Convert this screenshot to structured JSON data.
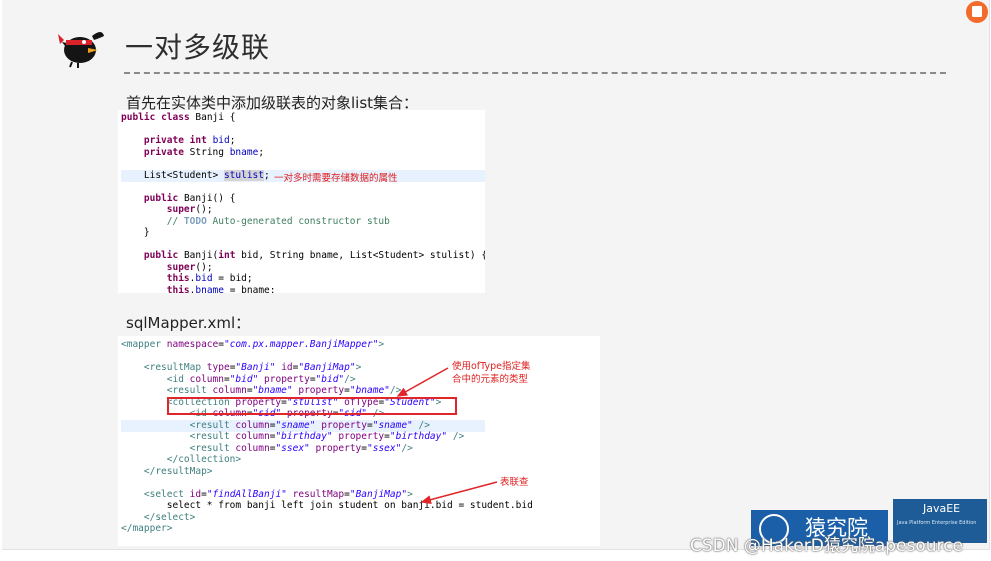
{
  "slide": {
    "title": "一对多级联",
    "subtitle_1": "首先在实体类中添加级联表的对象list集合：",
    "subtitle_2": "sqlMapper.xml："
  },
  "code_java": [
    {
      "t": [
        [
          "kw",
          "public"
        ],
        [
          "",
          " "
        ],
        [
          "kw",
          "class"
        ],
        [
          "",
          " Banji {"
        ]
      ]
    },
    {
      "t": []
    },
    {
      "t": [
        [
          "",
          "    "
        ],
        [
          "kw",
          "private"
        ],
        [
          "",
          " "
        ],
        [
          "kw",
          "int"
        ],
        [
          "",
          " "
        ],
        [
          "fld",
          "bid"
        ],
        [
          "",
          ";"
        ]
      ]
    },
    {
      "t": [
        [
          "",
          "    "
        ],
        [
          "kw",
          "private"
        ],
        [
          "",
          " String "
        ],
        [
          "fld",
          "bname"
        ],
        [
          "",
          ";"
        ]
      ]
    },
    {
      "t": []
    },
    {
      "t": [
        [
          "",
          "    List<Student> "
        ],
        [
          "fld",
          "stulist"
        ],
        [
          "",
          ";"
        ]
      ]
    },
    {
      "t": []
    },
    {
      "t": [
        [
          "",
          "    "
        ],
        [
          "kw",
          "public"
        ],
        [
          "",
          " Banji() {"
        ]
      ]
    },
    {
      "t": [
        [
          "",
          "        "
        ],
        [
          "kw",
          "super"
        ],
        [
          "",
          "();"
        ]
      ]
    },
    {
      "t": [
        [
          "cm",
          "        // "
        ],
        [
          "todo",
          "TODO"
        ],
        [
          "cm",
          " Auto-generated constructor stub"
        ]
      ]
    },
    {
      "t": [
        [
          "",
          "    }"
        ]
      ]
    },
    {
      "t": []
    },
    {
      "t": [
        [
          "",
          "    "
        ],
        [
          "kw",
          "public"
        ],
        [
          "",
          " Banji("
        ],
        [
          "kw",
          "int"
        ],
        [
          "",
          " bid, String bname, List<Student> stulist) {"
        ]
      ]
    },
    {
      "t": [
        [
          "",
          "        "
        ],
        [
          "kw",
          "super"
        ],
        [
          "",
          "();"
        ]
      ]
    },
    {
      "t": [
        [
          "",
          "        "
        ],
        [
          "kw",
          "this"
        ],
        [
          "",
          "."
        ],
        [
          "fld",
          "bid"
        ],
        [
          "",
          " = bid;"
        ]
      ]
    },
    {
      "t": [
        [
          "",
          "        "
        ],
        [
          "kw",
          "this"
        ],
        [
          "",
          "."
        ],
        [
          "fld",
          "bname"
        ],
        [
          "",
          " = bname;"
        ]
      ]
    }
  ],
  "code_xml": [
    {
      "t": [
        [
          "tag",
          "<mapper "
        ],
        [
          "att",
          "namespace"
        ],
        [
          "",
          "="
        ],
        [
          "val",
          "\"com.px.mapper.BanjiMapper\""
        ],
        [
          "tag",
          ">"
        ]
      ]
    },
    {
      "t": []
    },
    {
      "t": [
        [
          "tag",
          "    <resultMap "
        ],
        [
          "att",
          "type"
        ],
        [
          "",
          "="
        ],
        [
          "val",
          "\"Banji\""
        ],
        [
          "",
          " "
        ],
        [
          "att",
          "id"
        ],
        [
          "",
          "="
        ],
        [
          "val",
          "\"BanjiMap\""
        ],
        [
          "tag",
          ">"
        ]
      ]
    },
    {
      "t": [
        [
          "tag",
          "        <id "
        ],
        [
          "att",
          "column"
        ],
        [
          "",
          "="
        ],
        [
          "val",
          "\"bid\""
        ],
        [
          "",
          " "
        ],
        [
          "att",
          "property"
        ],
        [
          "",
          "="
        ],
        [
          "val",
          "\"bid\""
        ],
        [
          "tag",
          "/>"
        ]
      ]
    },
    {
      "t": [
        [
          "tag",
          "        <result "
        ],
        [
          "att",
          "column"
        ],
        [
          "",
          "="
        ],
        [
          "val",
          "\"bname\""
        ],
        [
          "",
          " "
        ],
        [
          "att",
          "property"
        ],
        [
          "",
          "="
        ],
        [
          "val",
          "\"bname\""
        ],
        [
          "tag",
          "/>"
        ]
      ]
    },
    {
      "t": [
        [
          "tag",
          "        <collection "
        ],
        [
          "att",
          "property"
        ],
        [
          "",
          "="
        ],
        [
          "val",
          "\"stulist\""
        ],
        [
          "",
          " "
        ],
        [
          "att",
          "ofType"
        ],
        [
          "",
          "="
        ],
        [
          "val",
          "\"Student\""
        ],
        [
          "tag",
          ">"
        ]
      ]
    },
    {
      "t": [
        [
          "tag",
          "            <id "
        ],
        [
          "att",
          "column"
        ],
        [
          "",
          "="
        ],
        [
          "val",
          "\"sid\""
        ],
        [
          "",
          " "
        ],
        [
          "att",
          "property"
        ],
        [
          "",
          "="
        ],
        [
          "val",
          "\"sid\""
        ],
        [
          "tag",
          " />"
        ]
      ]
    },
    {
      "t": [
        [
          "tag",
          "            <result "
        ],
        [
          "att",
          "column"
        ],
        [
          "",
          "="
        ],
        [
          "val",
          "\"sname\""
        ],
        [
          "",
          " "
        ],
        [
          "att",
          "property"
        ],
        [
          "",
          "="
        ],
        [
          "val",
          "\"sname\""
        ],
        [
          "tag",
          " />"
        ]
      ]
    },
    {
      "t": [
        [
          "tag",
          "            <result "
        ],
        [
          "att",
          "column"
        ],
        [
          "",
          "="
        ],
        [
          "val",
          "\"birthday\""
        ],
        [
          "",
          " "
        ],
        [
          "att",
          "property"
        ],
        [
          "",
          "="
        ],
        [
          "val",
          "\"birthday\""
        ],
        [
          "tag",
          " />"
        ]
      ]
    },
    {
      "t": [
        [
          "tag",
          "            <result "
        ],
        [
          "att",
          "column"
        ],
        [
          "",
          "="
        ],
        [
          "val",
          "\"ssex\""
        ],
        [
          "",
          " "
        ],
        [
          "att",
          "property"
        ],
        [
          "",
          "="
        ],
        [
          "val",
          "\"ssex\""
        ],
        [
          "tag",
          "/>"
        ]
      ]
    },
    {
      "t": [
        [
          "tag",
          "        </collection>"
        ]
      ]
    },
    {
      "t": [
        [
          "tag",
          "    </resultMap>"
        ]
      ]
    },
    {
      "t": []
    },
    {
      "t": [
        [
          "tag",
          "    <select "
        ],
        [
          "att",
          "id"
        ],
        [
          "",
          "="
        ],
        [
          "val",
          "\"findAllBanji\""
        ],
        [
          "",
          " "
        ],
        [
          "att",
          "resultMap"
        ],
        [
          "",
          "="
        ],
        [
          "val",
          "\"BanjiMap\""
        ],
        [
          "tag",
          ">"
        ]
      ]
    },
    {
      "t": [
        [
          "",
          "        select * from banji left join student on banji.bid = student.bid"
        ]
      ]
    },
    {
      "t": [
        [
          "tag",
          "    </select>"
        ]
      ]
    },
    {
      "t": [
        [
          "tag",
          "</mapper>"
        ]
      ]
    }
  ],
  "annotations": {
    "stulist_note": "一对多时需要存储数据的属性",
    "oftype_note_1": "使用ofType指定集",
    "oftype_note_2": "合中的元素的类型",
    "join_note": "表联查"
  },
  "branding": {
    "logo_text": "猿究院",
    "java_title": "JavaEE",
    "java_sub": "Java Platform Enterprise Edition",
    "watermark": "CSDN @HakerD猿究院apesource"
  },
  "colors": {
    "annotation_red": "#e02020",
    "accent_orange": "#f26b2a",
    "logo_blue": "#1a5fa8"
  },
  "icons": {
    "mascot": "ninja-bird-icon",
    "corner": "document-icon",
    "logo": "circle-emblem-icon"
  }
}
